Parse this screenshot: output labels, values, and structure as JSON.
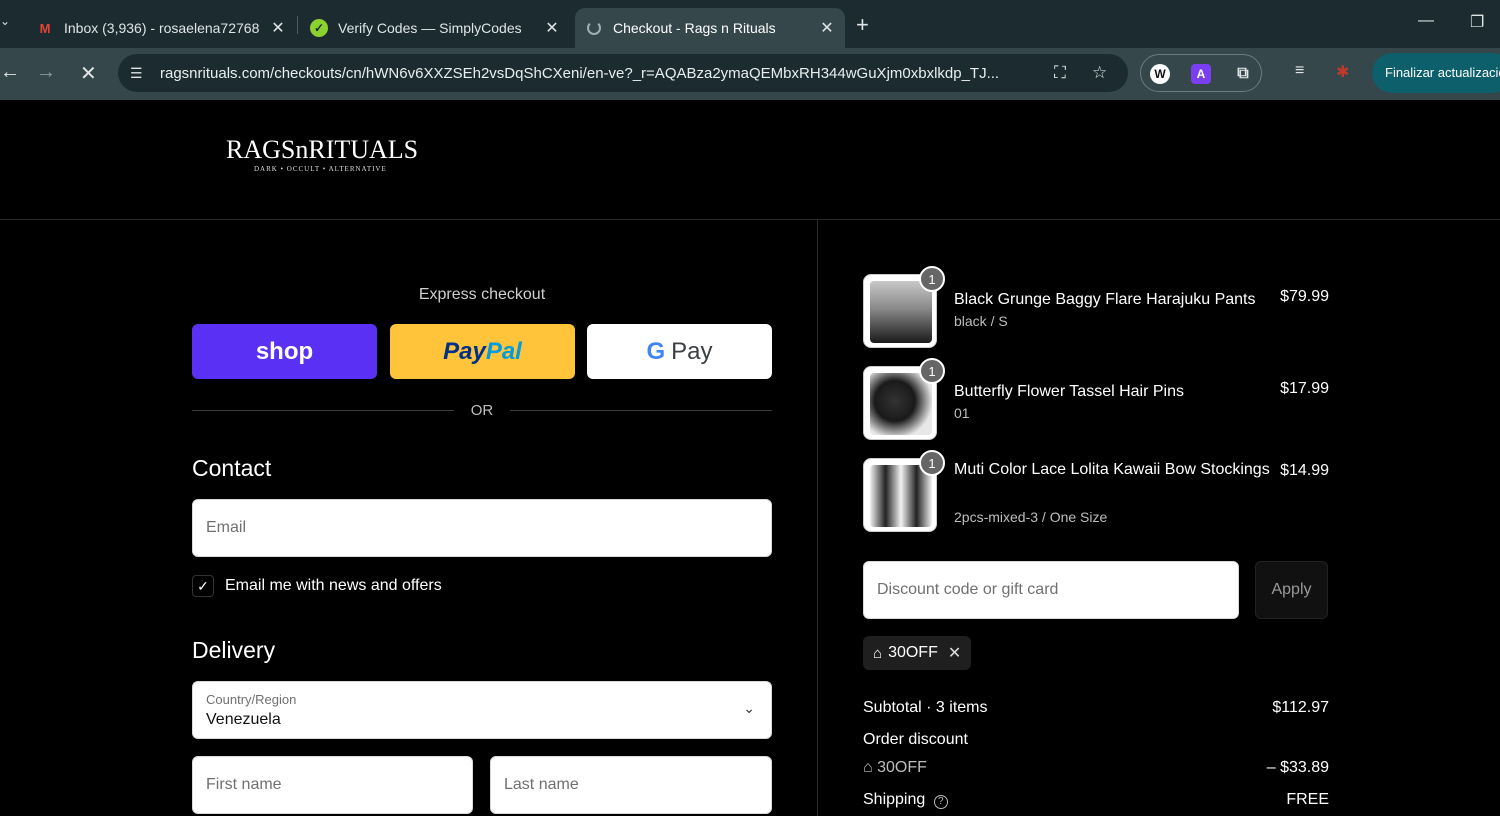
{
  "browser": {
    "tabs": [
      {
        "title": "Inbox (3,936) - rosaelena72768",
        "icon": "gmail-icon"
      },
      {
        "title": "Verify Codes — SimplyCodes",
        "icon": "simplycodes-icon"
      },
      {
        "title": "Checkout - Rags n Rituals",
        "icon": "loading-icon"
      }
    ],
    "url": "ragsnrituals.com/checkouts/cn/hWN6v6XXZSEh2vsDqShCXeni/en-ve?_r=AQABza2ymaQEMbxRH344wGuXjm0xbxlkdp_TJ...",
    "update_label": "Finalizar actualización"
  },
  "brand": {
    "name": "RAGSnRITUALS",
    "tagline": "DARK • OCCULT • ALTERNATIVE"
  },
  "checkout": {
    "express_title": "Express checkout",
    "shop_label": "shop",
    "paypal_label_1": "Pay",
    "paypal_label_2": "Pal",
    "gpay_label": "Pay",
    "or_label": "OR",
    "contact_title": "Contact",
    "email_placeholder": "Email",
    "news_label": "Email me with news and offers",
    "news_checked": true,
    "delivery_title": "Delivery",
    "country_label": "Country/Region",
    "country_value": "Venezuela",
    "first_name_placeholder": "First name",
    "last_name_placeholder": "Last name"
  },
  "summary": {
    "items": [
      {
        "name": "Black Grunge Baggy Flare Harajuku Pants",
        "variant": "black / S",
        "price": "$79.99",
        "qty": "1"
      },
      {
        "name": "Butterfly Flower Tassel Hair Pins",
        "variant": "01",
        "price": "$17.99",
        "qty": "1"
      },
      {
        "name": "Muti Color Lace Lolita Kawaii Bow Stockings",
        "variant": "2pcs-mixed-3 / One Size",
        "price": "$14.99",
        "qty": "1"
      }
    ],
    "discount_placeholder": "Discount code or gift card",
    "apply_label": "Apply",
    "applied_code": "30OFF",
    "subtotal_label": "Subtotal · 3 items",
    "subtotal_value": "$112.97",
    "order_discount_label": "Order discount",
    "order_discount_code": "30OFF",
    "order_discount_value": "– $33.89",
    "shipping_label": "Shipping",
    "shipping_value": "FREE"
  }
}
